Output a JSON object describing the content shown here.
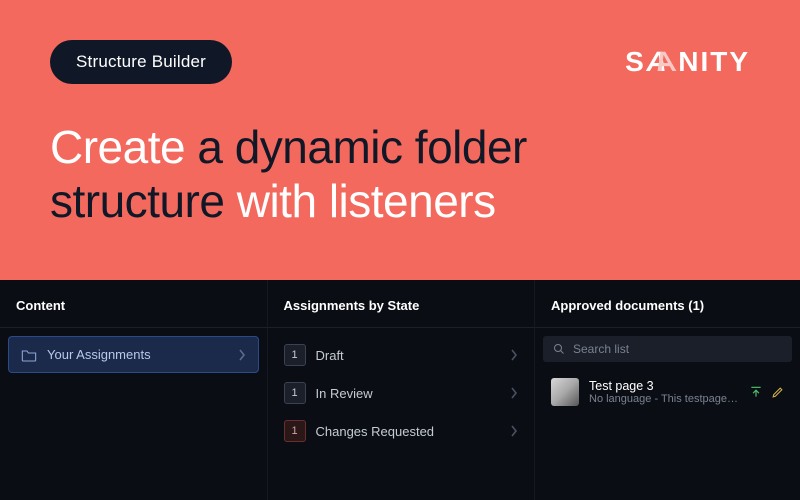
{
  "hero": {
    "pill": "Structure Builder",
    "title_word1": "Create",
    "title_rest1": " a dynamic folder",
    "title_word2": "structure",
    "title_rest2": " with listeners",
    "logo_text": "SANITY"
  },
  "panels": {
    "col1": {
      "header": "Content",
      "active_item": "Your Assignments"
    },
    "col2": {
      "header": "Assignments by State",
      "states": [
        {
          "count": "1",
          "label": "Draft",
          "variant": "normal"
        },
        {
          "count": "1",
          "label": "In Review",
          "variant": "normal"
        },
        {
          "count": "1",
          "label": "Changes Requested",
          "variant": "red"
        }
      ]
    },
    "col3": {
      "header": "Approved documents (1)",
      "search_placeholder": "Search list",
      "doc": {
        "title": "Test page 3",
        "subtitle": "No language - This testpage does..."
      }
    }
  }
}
